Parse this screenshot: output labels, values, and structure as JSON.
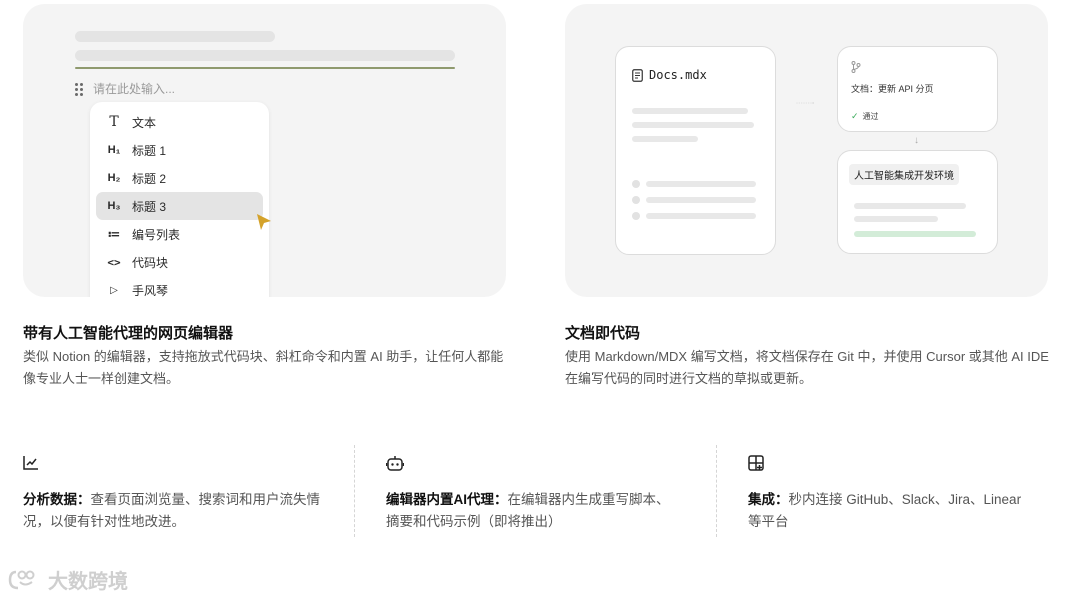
{
  "editor_card": {
    "placeholder": "请在此处输入...",
    "menu_items": [
      {
        "icon": "T",
        "label": "文本"
      },
      {
        "icon": "H₁",
        "label": "标题 1"
      },
      {
        "icon": "H₂",
        "label": "标题 2"
      },
      {
        "icon": "H₃",
        "label": "标题 3"
      },
      {
        "icon": "≔",
        "label": "编号列表"
      },
      {
        "icon": "<>",
        "label": "代码块"
      },
      {
        "icon": "▷",
        "label": "手风琴"
      }
    ],
    "accent_color": "#d4a22a"
  },
  "docs_card": {
    "file_name": "Docs.mdx",
    "pr_title": "文档：更新 API 分页",
    "pr_status": "通过",
    "ide_label": "人工智能集成开发环境"
  },
  "sections": {
    "left_title": "带有人工智能代理的网页编辑器",
    "left_desc": "类似 Notion 的编辑器，支持拖放式代码块、斜杠命令和内置 AI 助手，让任何人都能像专业人士一样创建文档。",
    "right_title": "文档即代码",
    "right_desc": "使用 Markdown/MDX 编写文档，将文档保存在 Git 中，并使用 Cursor 或其他 AI IDE 在编写代码的同时进行文档的草拟或更新。"
  },
  "features": [
    {
      "icon": "chart-icon",
      "title": "分析数据：",
      "text": "查看页面浏览量、搜索词和用户流失情况，以便有针对性地改进。"
    },
    {
      "icon": "robot-icon",
      "title": "编辑器内置AI代理：",
      "text": "在编辑器内生成重写脚本、摘要和代码示例（即将推出）"
    },
    {
      "icon": "grid-plus-icon",
      "title": "集成：",
      "text": "秒内连接 GitHub、Slack、Jira、Linear 等平台"
    }
  ],
  "watermark": "大数跨境"
}
